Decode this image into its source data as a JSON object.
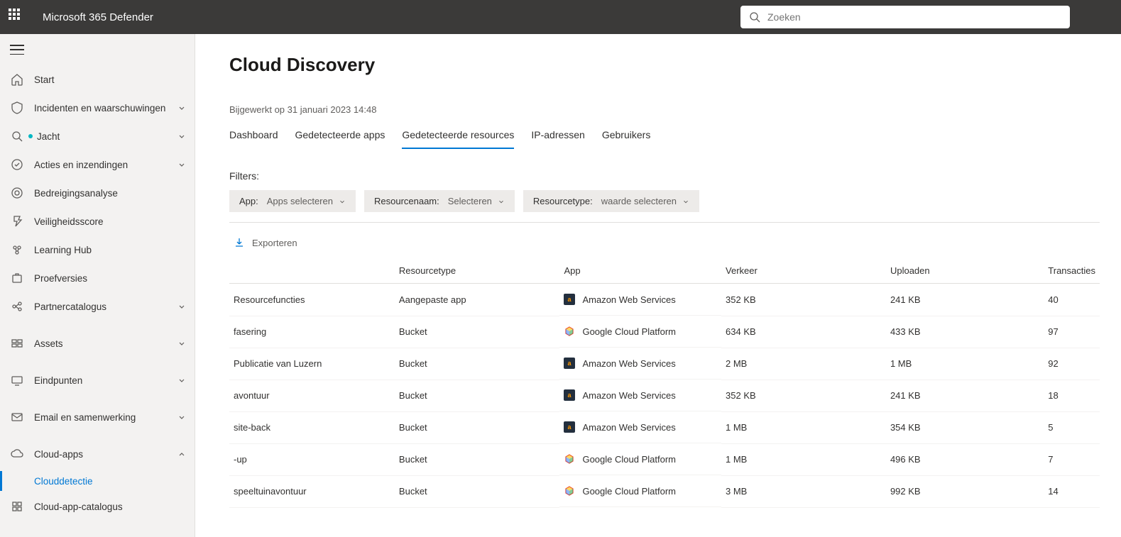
{
  "header": {
    "product": "Microsoft 365 Defender",
    "search_placeholder": "Zoeken"
  },
  "sidebar": {
    "items": [
      {
        "key": "home",
        "label": "Start",
        "expandable": false
      },
      {
        "key": "incidents",
        "label": "Incidenten en waarschuwingen",
        "expandable": true
      },
      {
        "key": "hunting",
        "label": "Jacht",
        "expandable": true,
        "dot": true
      },
      {
        "key": "actions",
        "label": "Acties en inzendingen",
        "expandable": true
      },
      {
        "key": "threat",
        "label": "Bedreigingsanalyse",
        "expandable": false
      },
      {
        "key": "score",
        "label": "Veiligheidsscore",
        "expandable": false
      },
      {
        "key": "learning",
        "label": "Learning Hub",
        "expandable": false
      },
      {
        "key": "trials",
        "label": "Proefversies",
        "expandable": false
      },
      {
        "key": "partner",
        "label": "Partnercatalogus",
        "expandable": true
      },
      {
        "key": "assets",
        "label": "Assets",
        "expandable": true,
        "sep_before": true
      },
      {
        "key": "endpoints",
        "label": "Eindpunten",
        "expandable": true,
        "sep_before": true
      },
      {
        "key": "email",
        "label": "Email en samenwerking",
        "expandable": true,
        "sep_before": true
      },
      {
        "key": "cloudapps",
        "label": "Cloud-apps",
        "expandable": true,
        "expanded": true,
        "sep_before": true
      },
      {
        "key": "clouddetection",
        "label": "Clouddetectie",
        "expandable": false,
        "sub": true,
        "active": true
      },
      {
        "key": "cloudcatalog",
        "label": "Cloud-app-catalogus",
        "expandable": false,
        "sub": true
      }
    ]
  },
  "page": {
    "title": "Cloud Discovery",
    "updated": "Bijgewerkt op 31 januari 2023 14:48"
  },
  "tabs": [
    {
      "key": "dashboard",
      "label": "Dashboard"
    },
    {
      "key": "disc_apps",
      "label": "Gedetecteerde apps"
    },
    {
      "key": "disc_res",
      "label": "Gedetecteerde resources",
      "active": true
    },
    {
      "key": "ips",
      "label": "IP-adressen"
    },
    {
      "key": "users",
      "label": "Gebruikers"
    }
  ],
  "filters": {
    "label": "Filters:",
    "chips": [
      {
        "key": "app",
        "prefix": "App:",
        "value": "Apps selecteren"
      },
      {
        "key": "resname",
        "prefix": "Resourcenaam:",
        "value": "Selecteren"
      },
      {
        "key": "restype",
        "prefix": "Resourcetype:",
        "value": "waarde selecteren"
      }
    ]
  },
  "export_label": "Exporteren",
  "table": {
    "columns": {
      "name": "",
      "type": "Resourcetype",
      "app": "App",
      "traffic": "Verkeer",
      "upload": "Uploaden",
      "trans": "Transacties"
    },
    "rows": [
      {
        "name": "Resourcefuncties",
        "type": "Aangepaste app",
        "app": "Amazon Web Services",
        "app_icon": "aws",
        "traffic": "352 KB",
        "upload": "241 KB",
        "trans": "40"
      },
      {
        "name": "fasering",
        "type": "Bucket",
        "app": "Google Cloud Platform",
        "app_icon": "gcp",
        "traffic": "634 KB",
        "upload": "433 KB",
        "trans": "97"
      },
      {
        "name": "Publicatie van Luzern",
        "type": "Bucket",
        "app": "Amazon Web Services",
        "app_icon": "aws",
        "traffic": "2 MB",
        "upload": "1 MB",
        "trans": "92"
      },
      {
        "name": "avontuur",
        "type": "Bucket",
        "app": "Amazon Web Services",
        "app_icon": "aws",
        "traffic": "352 KB",
        "upload": "241 KB",
        "trans": "18"
      },
      {
        "name": "site-back",
        "type": "Bucket",
        "app": "Amazon Web Services",
        "app_icon": "aws",
        "traffic": "1 MB",
        "upload": "354 KB",
        "trans": "5"
      },
      {
        "name": "-up",
        "type": "Bucket",
        "app": "Google Cloud Platform",
        "app_icon": "gcp",
        "traffic": "1 MB",
        "upload": "496 KB",
        "trans": "7"
      },
      {
        "name": "speeltuinavontuur",
        "type": "Bucket",
        "app": "Google Cloud Platform",
        "app_icon": "gcp",
        "traffic": "3 MB",
        "upload": "992 KB",
        "trans": "14"
      }
    ]
  }
}
